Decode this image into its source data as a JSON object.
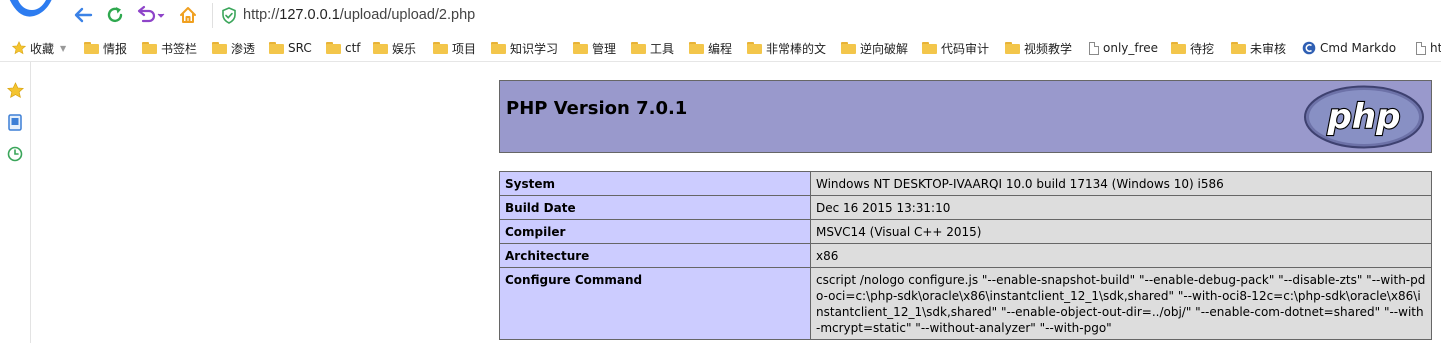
{
  "browser": {
    "url_prefix": "http://",
    "url_host": "127.0.0.1",
    "url_path": "/upload/upload/2.php"
  },
  "bookmarks": [
    {
      "label": "收藏",
      "icon": "star-icon",
      "has_caret": true
    },
    {
      "label": "情报",
      "icon": "folder-icon"
    },
    {
      "label": "书签栏",
      "icon": "folder-icon"
    },
    {
      "label": "渗透",
      "icon": "folder-icon"
    },
    {
      "label": "SRC",
      "icon": "folder-icon"
    },
    {
      "label": "ctf",
      "icon": "folder-icon"
    },
    {
      "label": "娱乐",
      "icon": "folder-icon"
    },
    {
      "label": "项目",
      "icon": "folder-icon"
    },
    {
      "label": "知识学习",
      "icon": "folder-icon"
    },
    {
      "label": "管理",
      "icon": "folder-icon"
    },
    {
      "label": "工具",
      "icon": "folder-icon"
    },
    {
      "label": "编程",
      "icon": "folder-icon"
    },
    {
      "label": "非常棒的文",
      "icon": "folder-icon"
    },
    {
      "label": "逆向破解",
      "icon": "folder-icon"
    },
    {
      "label": "代码审计",
      "icon": "folder-icon"
    },
    {
      "label": "视频教学",
      "icon": "folder-icon"
    },
    {
      "label": "only_free",
      "icon": "page-icon"
    },
    {
      "label": "待挖",
      "icon": "folder-icon"
    },
    {
      "label": "未审核",
      "icon": "folder-icon"
    },
    {
      "label": "Cmd Markdo",
      "icon": "cmd-markdown-icon"
    },
    {
      "label": "ht",
      "icon": "page-icon"
    }
  ],
  "sidebar": [
    "star-icon",
    "reader-icon",
    "history-icon"
  ],
  "page": {
    "title": "PHP Version 7.0.1",
    "logo_text": "php",
    "rows": [
      {
        "key": "System",
        "value": "Windows NT DESKTOP-IVAARQI 10.0 build 17134 (Windows 10) i586"
      },
      {
        "key": "Build Date",
        "value": "Dec 16 2015 13:31:10"
      },
      {
        "key": "Compiler",
        "value": "MSVC14 (Visual C++ 2015)"
      },
      {
        "key": "Architecture",
        "value": "x86"
      },
      {
        "key": "Configure Command",
        "value": "cscript /nologo configure.js \"--enable-snapshot-build\" \"--enable-debug-pack\" \"--disable-zts\" \"--with-pdo-oci=c:\\php-sdk\\oracle\\x86\\instantclient_12_1\\sdk,shared\" \"--with-oci8-12c=c:\\php-sdk\\oracle\\x86\\instantclient_12_1\\sdk,shared\" \"--enable-object-out-dir=../obj/\" \"--enable-com-dotnet=shared\" \"--with-mcrypt=static\" \"--without-analyzer\" \"--with-pgo\""
      }
    ]
  },
  "colors": {
    "header_bg": "#9999cc",
    "key_bg": "#ccccff",
    "value_bg": "#dddddd",
    "folder": "#f3c64b"
  }
}
